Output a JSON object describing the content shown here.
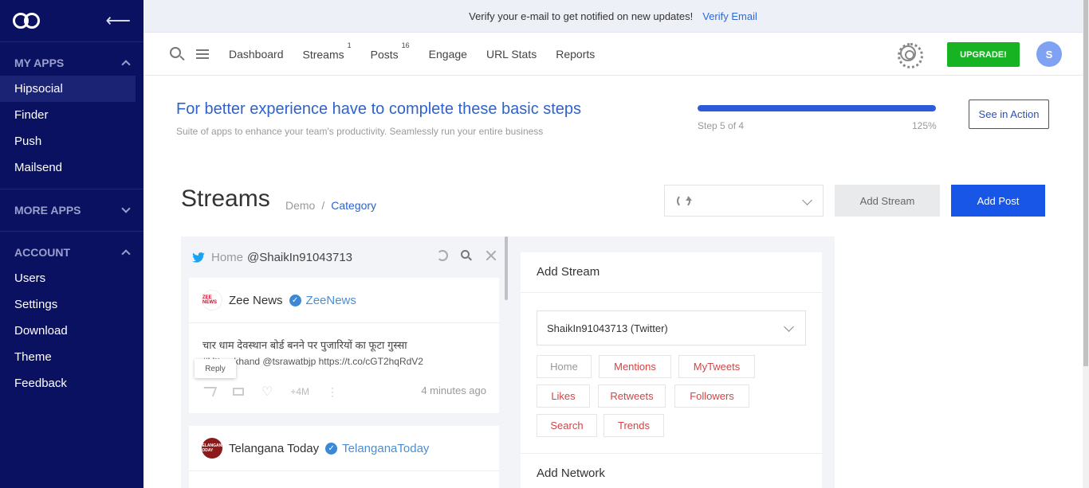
{
  "sidebar": {
    "sections": {
      "my_apps": {
        "label": "MY APPS",
        "items": [
          "Hipsocial",
          "Finder",
          "Push",
          "Mailsend"
        ]
      },
      "more_apps": {
        "label": "MORE APPS"
      },
      "account": {
        "label": "ACCOUNT",
        "items": [
          "Users",
          "Settings",
          "Download",
          "Theme",
          "Feedback"
        ]
      }
    },
    "active_item": "Hipsocial"
  },
  "banner": {
    "text": "Verify your e-mail to get notified on new updates!",
    "link": "Verify Email"
  },
  "nav": {
    "links": [
      {
        "label": "Dashboard",
        "badge": ""
      },
      {
        "label": "Streams",
        "badge": "1"
      },
      {
        "label": "Posts",
        "badge": "16"
      },
      {
        "label": "Engage",
        "badge": ""
      },
      {
        "label": "URL Stats",
        "badge": ""
      },
      {
        "label": "Reports",
        "badge": ""
      }
    ],
    "upgrade_label": "UPGRADE!",
    "avatar_initial": "S"
  },
  "steps": {
    "title": "For better experience have to complete these basic steps",
    "subtitle": "Suite of apps to enhance your team's productivity. Seamlessly run your entire business",
    "step_label": "Step 5 of 4",
    "percent_label": "125%",
    "progress_fraction": 1.0,
    "action_label": "See in Action"
  },
  "streams": {
    "title": "Streams",
    "breadcrumb": {
      "root": "Demo",
      "sep": "/",
      "current": "Category"
    },
    "add_stream_label": "Add Stream",
    "add_post_label": "Add Post"
  },
  "column": {
    "home_label": "Home",
    "account": "@ShaikIn91043713"
  },
  "tweets": [
    {
      "name": "Zee News",
      "handle": "ZeeNews",
      "logo_text": "ZEE NEWS",
      "text_line1": "चार धाम देवस्थान बोर्ड बनने पर पुजारियों का फूटा गुस्सा",
      "text_line2": "#Uttarakhand @tsrawatbjp https://t.co/cGT2hqRdV2",
      "tooltip": "Reply",
      "count": "4M",
      "time": "4 minutes ago"
    },
    {
      "name": "Telangana Today",
      "handle": "TelanganaToday",
      "logo_text": "TELANGANA TODAY"
    }
  ],
  "panel": {
    "title": "Add Stream",
    "account_select": "ShaikIn91043713 (Twitter)",
    "chips": [
      "Home",
      "Mentions",
      "MyTweets",
      "Likes",
      "Retweets",
      "Followers",
      "Search",
      "Trends"
    ],
    "network_title": "Add Network"
  },
  "colors": {
    "sidebar_bg": "#0a1161",
    "accent_blue": "#1756e6",
    "upgrade_green": "#17b322",
    "chip_red": "#d14545"
  }
}
